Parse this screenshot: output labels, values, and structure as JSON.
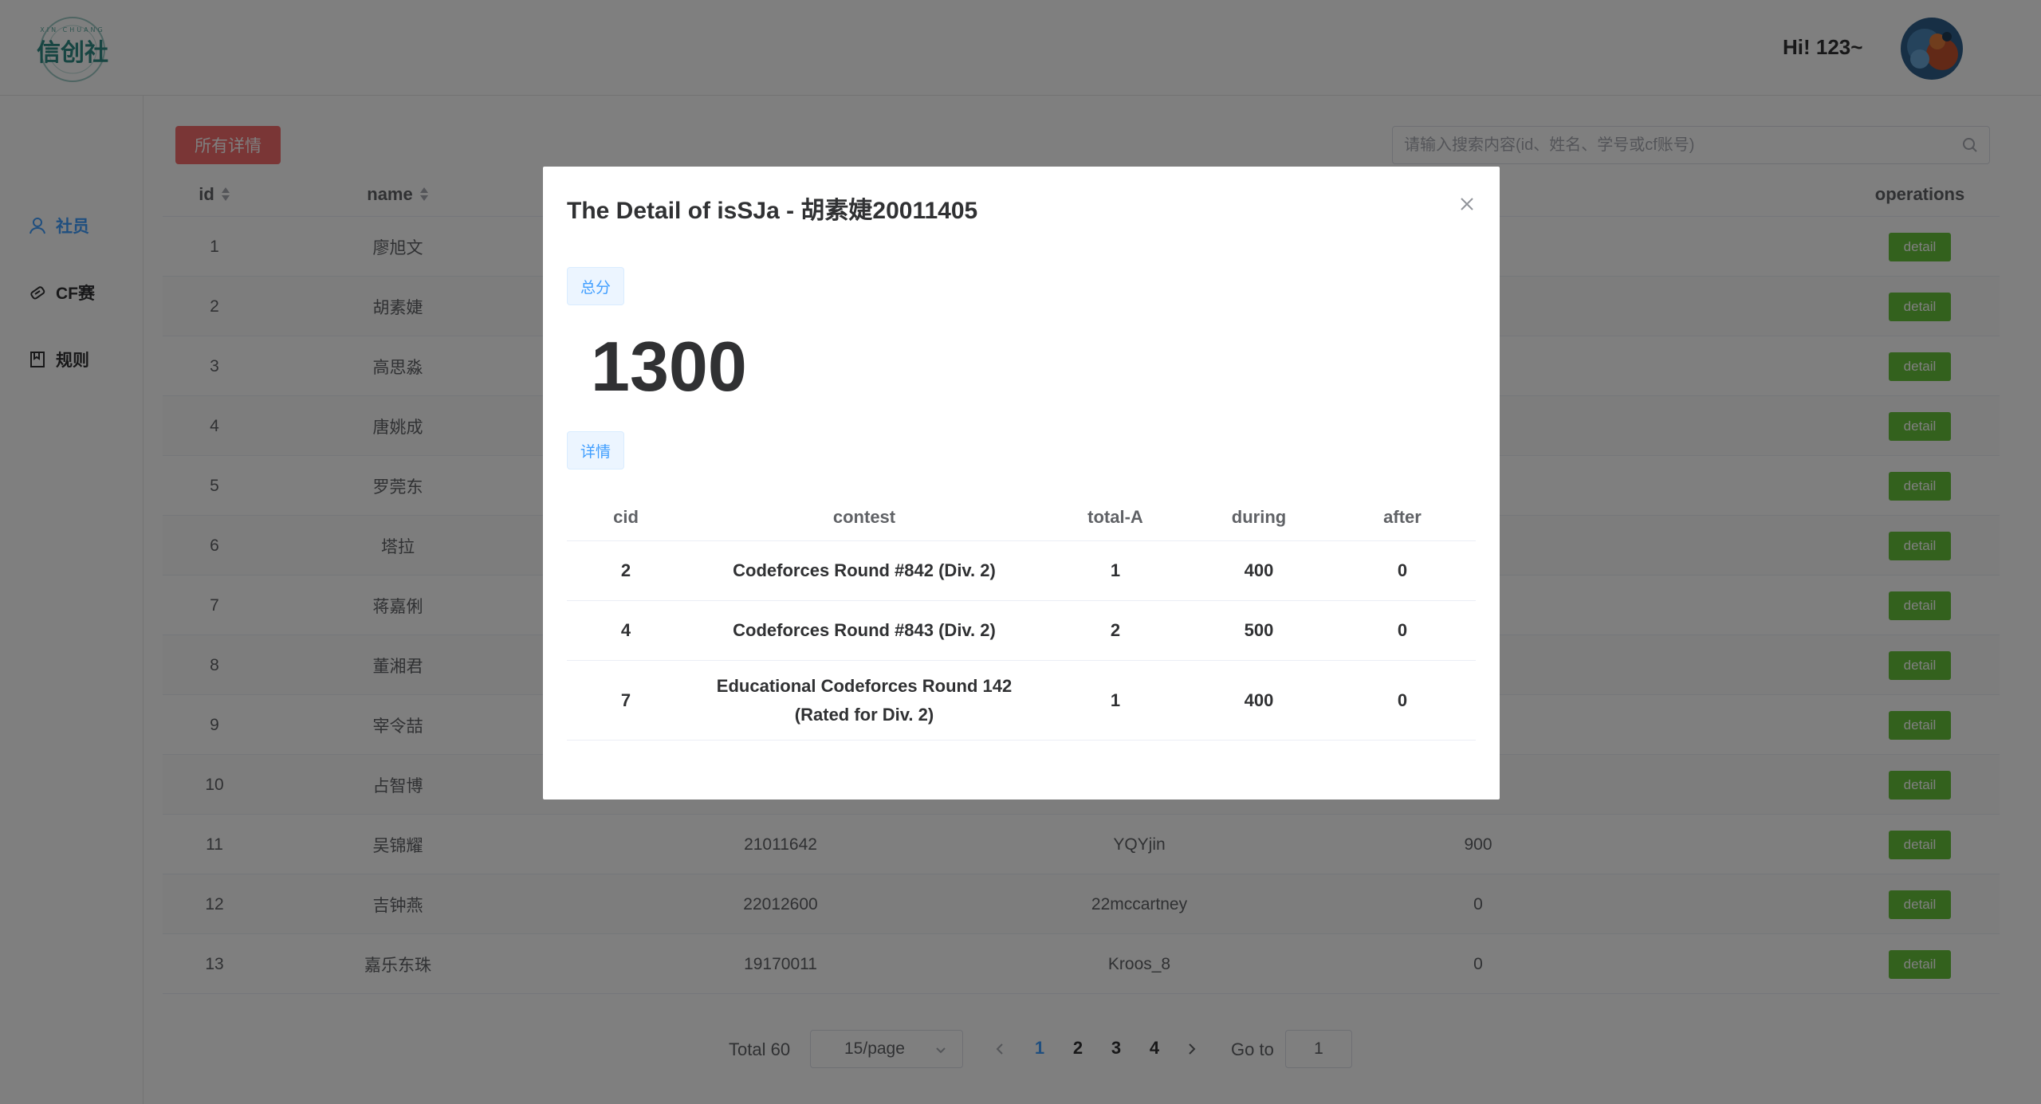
{
  "header": {
    "logo_text": "信创社",
    "logo_subtext": "XIN CHUANG",
    "greeting": "Hi! 123~"
  },
  "sidebar": {
    "items": [
      {
        "label": "社员",
        "icon": "user-icon",
        "active": true
      },
      {
        "label": "CF赛",
        "icon": "medal-icon",
        "active": false
      },
      {
        "label": "规则",
        "icon": "book-icon",
        "active": false
      }
    ]
  },
  "toolbar": {
    "all_details_label": "所有详情",
    "search_placeholder": "请输入搜索内容(id、姓名、学号或cf账号)"
  },
  "table": {
    "columns": [
      "id",
      "name",
      "",
      "",
      "",
      "operations"
    ],
    "rows": [
      {
        "id": "1",
        "name": "廖旭文",
        "sid": "",
        "cf": "",
        "score": "",
        "op": "detail"
      },
      {
        "id": "2",
        "name": "胡素婕",
        "sid": "",
        "cf": "",
        "score": "",
        "op": "detail"
      },
      {
        "id": "3",
        "name": "高思淼",
        "sid": "",
        "cf": "",
        "score": "",
        "op": "detail"
      },
      {
        "id": "4",
        "name": "唐姚成",
        "sid": "",
        "cf": "",
        "score": "",
        "op": "detail"
      },
      {
        "id": "5",
        "name": "罗莞东",
        "sid": "",
        "cf": "",
        "score": "",
        "op": "detail"
      },
      {
        "id": "6",
        "name": "塔拉",
        "sid": "",
        "cf": "",
        "score": "",
        "op": "detail"
      },
      {
        "id": "7",
        "name": "蒋嘉俐",
        "sid": "",
        "cf": "",
        "score": "",
        "op": "detail"
      },
      {
        "id": "8",
        "name": "董湘君",
        "sid": "",
        "cf": "",
        "score": "",
        "op": "detail"
      },
      {
        "id": "9",
        "name": "宰令喆",
        "sid": "",
        "cf": "",
        "score": "",
        "op": "detail"
      },
      {
        "id": "10",
        "name": "占智博",
        "sid": "",
        "cf": "",
        "score": "",
        "op": "detail"
      },
      {
        "id": "11",
        "name": "吴锦耀",
        "sid": "21011642",
        "cf": "YQYjin",
        "score": "900",
        "op": "detail"
      },
      {
        "id": "12",
        "name": "吉钟燕",
        "sid": "22012600",
        "cf": "22mccartney",
        "score": "0",
        "op": "detail"
      },
      {
        "id": "13",
        "name": "嘉乐东珠",
        "sid": "19170011",
        "cf": "Kroos_8",
        "score": "0",
        "op": "detail"
      }
    ]
  },
  "pagination": {
    "total": "Total 60",
    "page_size": "15/page",
    "pages": [
      "1",
      "2",
      "3",
      "4"
    ],
    "current": "1",
    "goto_label": "Go to",
    "goto_value": "1"
  },
  "dialog": {
    "title": "The Detail of isSJa - 胡素婕20011405",
    "total_tag": "总分",
    "total_score": "1300",
    "detail_tag": "详情",
    "columns": [
      "cid",
      "contest",
      "total-A",
      "during",
      "after"
    ],
    "rows": [
      {
        "cid": "2",
        "contest": "Codeforces Round #842 (Div. 2)",
        "total_a": "1",
        "during": "400",
        "after": "0"
      },
      {
        "cid": "4",
        "contest": "Codeforces Round #843 (Div. 2)",
        "total_a": "2",
        "during": "500",
        "after": "0"
      },
      {
        "cid": "7",
        "contest": "Educational Codeforces Round 142 (Rated for Div. 2)",
        "total_a": "1",
        "during": "400",
        "after": "0"
      }
    ]
  },
  "colors": {
    "primary": "#409eff",
    "danger": "#f56c6c",
    "success": "#67c23a"
  }
}
